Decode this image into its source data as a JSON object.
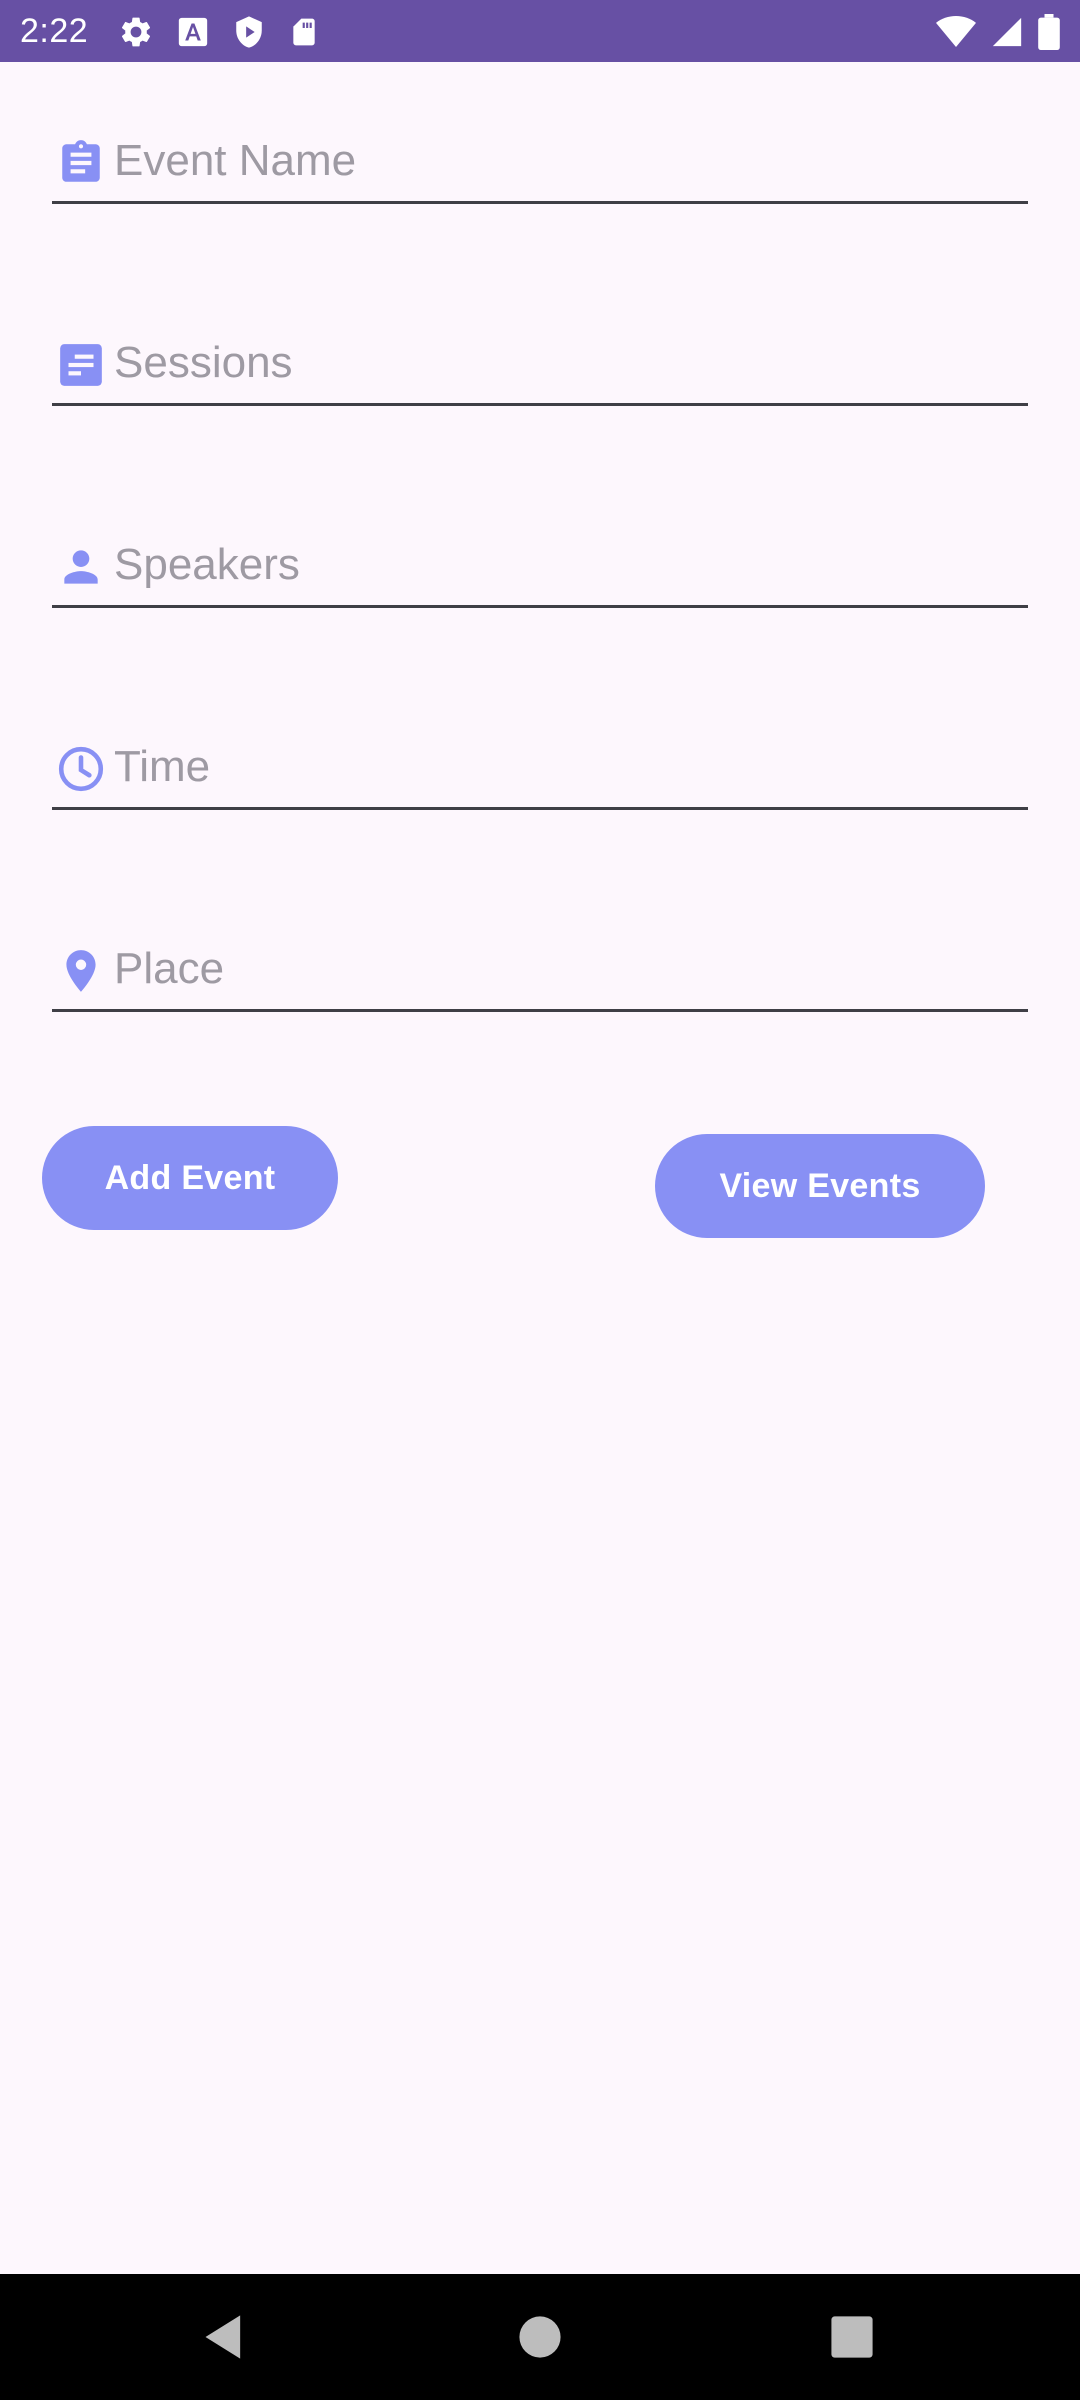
{
  "status_bar": {
    "time": "2:22",
    "left_icons": [
      "gear-icon",
      "font-a-icon",
      "shield-play-icon",
      "sd-card-icon"
    ],
    "right_icons": [
      "wifi-icon",
      "signal-icon",
      "battery-icon"
    ]
  },
  "form": {
    "event_name": {
      "placeholder": "Event Name",
      "value": "",
      "icon": "clipboard-icon"
    },
    "sessions": {
      "placeholder": "Sessions",
      "value": "",
      "icon": "notes-icon"
    },
    "speakers": {
      "placeholder": "Speakers",
      "value": "",
      "icon": "person-icon"
    },
    "time": {
      "placeholder": "Time",
      "value": "",
      "icon": "clock-icon"
    },
    "place": {
      "placeholder": "Place",
      "value": "",
      "icon": "location-pin-icon"
    }
  },
  "buttons": {
    "add_event": "Add Event",
    "view_events": "View Events"
  },
  "colors": {
    "status_bar": "#6750a4",
    "accent": "#8890f4",
    "background": "#fdf7fd"
  },
  "nav_bar": {
    "items": [
      "back-icon",
      "home-icon",
      "recents-icon"
    ]
  }
}
